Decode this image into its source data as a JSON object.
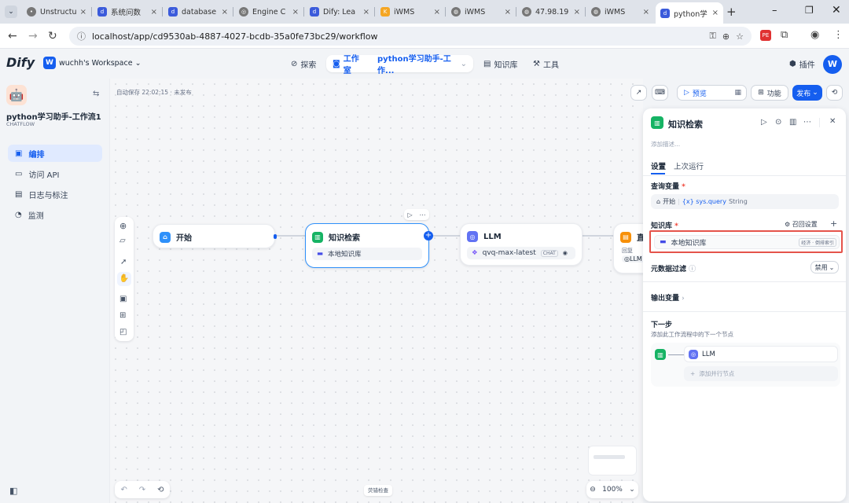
{
  "browser": {
    "tabs": [
      {
        "title": "Unstructu",
        "icon": "paw-icon"
      },
      {
        "title": "系统问数",
        "icon": "dify-icon"
      },
      {
        "title": "database",
        "icon": "dify-icon"
      },
      {
        "title": "Engine C",
        "icon": "engine-icon"
      },
      {
        "title": "Dify: Lea",
        "icon": "dify-icon"
      },
      {
        "title": "iWMS",
        "icon": "k-icon"
      },
      {
        "title": "iWMS",
        "icon": "globe-icon"
      },
      {
        "title": "47.98.19",
        "icon": "globe-icon"
      },
      {
        "title": "iWMS",
        "icon": "globe-icon"
      },
      {
        "title": "python学",
        "icon": "dify-icon"
      }
    ],
    "url": "localhost/app/cd9530ab-4887-4027-bcdb-35a0fe73bc29/workflow"
  },
  "header": {
    "logo": "Dify",
    "workspace_initial": "W",
    "workspace": "wuchh's Workspace",
    "nav_explore": "探索",
    "nav_studio": "工作室",
    "nav_app": "python学习助手-工作...",
    "nav_knowledge": "知识库",
    "nav_tools": "工具",
    "plugins": "插件",
    "avatar": "W"
  },
  "sidebar": {
    "app_name": "python学习助手-工作流1",
    "app_type": "CHATFLOW",
    "items": [
      {
        "label": "编排",
        "icon": "layers-icon"
      },
      {
        "label": "访问 API",
        "icon": "terminal-icon"
      },
      {
        "label": "日志与标注",
        "icon": "file-icon"
      },
      {
        "label": "监测",
        "icon": "monitor-icon"
      }
    ]
  },
  "canvas": {
    "autosave": "自动保存 22:02:15 · 未发布",
    "preview": "预览",
    "features": "功能",
    "publish": "发布",
    "checklist": "荧错检查",
    "zoom": "100%",
    "nodes": {
      "start": {
        "title": "开始"
      },
      "knowledge": {
        "title": "知识检索",
        "dataset": "本地知识库"
      },
      "llm": {
        "title": "LLM",
        "model": "qvq-max-latest",
        "badge": "CHAT"
      },
      "answer": {
        "title": "直",
        "label": "回复",
        "ref": "LLM"
      }
    }
  },
  "panel": {
    "title": "知识检索",
    "description_placeholder": "添加描述...",
    "tab_settings": "设置",
    "tab_last_run": "上次运行",
    "query_var_label": "查询变量",
    "query_var_source": "开始",
    "query_var_name": "{x} sys.query",
    "query_var_type": "String",
    "kb_label": "知识库",
    "recall_settings": "召回设置",
    "kb_item": "本地知识库",
    "kb_item_tag": "经济 · 倒排索引",
    "metadata_filter": "元数据过滤",
    "metadata_value": "禁用",
    "output_vars": "输出变量",
    "next_step": "下一步",
    "next_step_desc": "添加此工作流程中的下一个节点",
    "next_node": "LLM",
    "add_parallel": "添加并行节点"
  }
}
